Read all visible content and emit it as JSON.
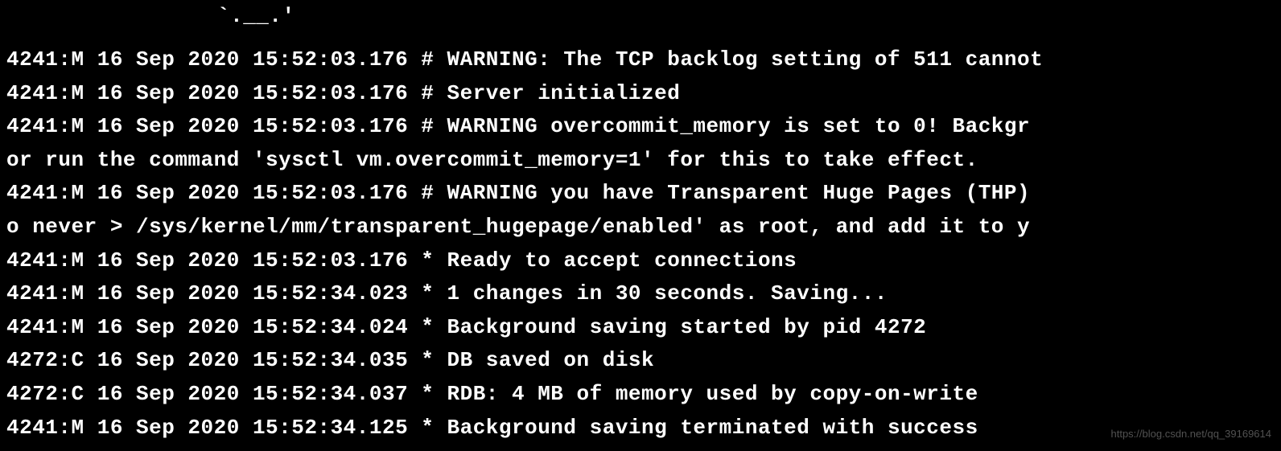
{
  "top_fragment": "`.__.'",
  "lines": [
    "4241:M 16 Sep 2020 15:52:03.176 # WARNING: The TCP backlog setting of 511 cannot",
    "4241:M 16 Sep 2020 15:52:03.176 # Server initialized",
    "4241:M 16 Sep 2020 15:52:03.176 # WARNING overcommit_memory is set to 0! Backgr",
    "or run the command 'sysctl vm.overcommit_memory=1' for this to take effect.",
    "4241:M 16 Sep 2020 15:52:03.176 # WARNING you have Transparent Huge Pages (THP)",
    "o never > /sys/kernel/mm/transparent_hugepage/enabled' as root, and add it to y",
    "4241:M 16 Sep 2020 15:52:03.176 * Ready to accept connections",
    "4241:M 16 Sep 2020 15:52:34.023 * 1 changes in 30 seconds. Saving...",
    "4241:M 16 Sep 2020 15:52:34.024 * Background saving started by pid 4272",
    "4272:C 16 Sep 2020 15:52:34.035 * DB saved on disk",
    "4272:C 16 Sep 2020 15:52:34.037 * RDB: 4 MB of memory used by copy-on-write",
    "4241:M 16 Sep 2020 15:52:34.125 * Background saving terminated with success"
  ],
  "watermark": "https://blog.csdn.net/qq_39169614"
}
